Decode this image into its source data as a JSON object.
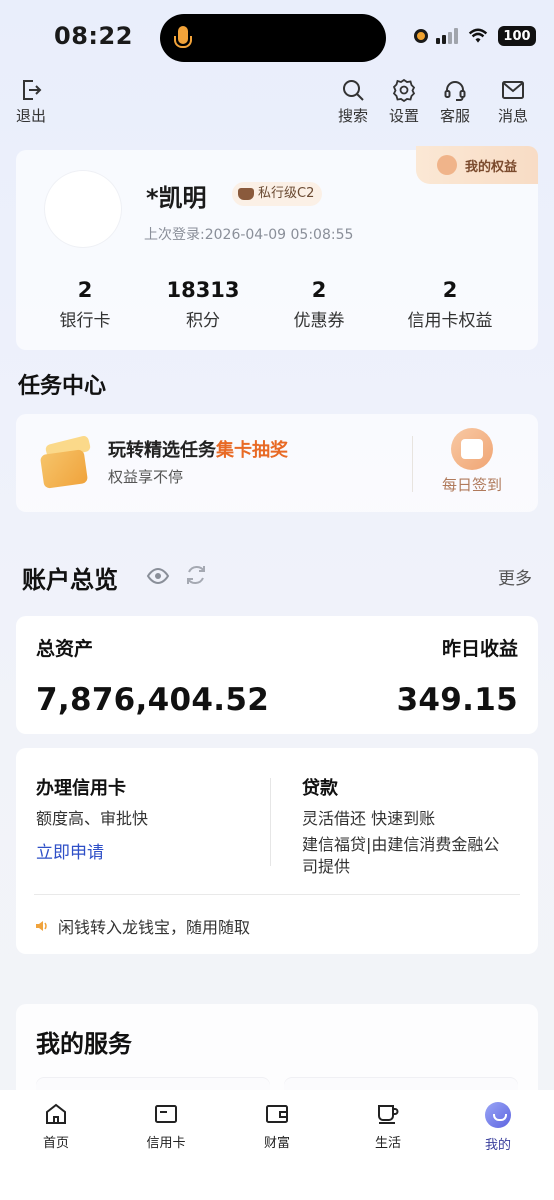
{
  "status_bar": {
    "time": "08:22",
    "battery": "100"
  },
  "top_nav": {
    "logout": "退出",
    "search": "搜索",
    "settings": "设置",
    "service": "客服",
    "messages": "消息"
  },
  "profile": {
    "name": "*凯明",
    "level": "私行级C2",
    "last_login": "上次登录:2026-04-09 05:08:55",
    "rights_tag": "我的权益",
    "stats": [
      {
        "value": "2",
        "label": "银行卡"
      },
      {
        "value": "18313",
        "label": "积分"
      },
      {
        "value": "2",
        "label": "优惠券"
      },
      {
        "value": "2",
        "label": "信用卡权益"
      }
    ]
  },
  "task_center": {
    "title": "任务中心",
    "headline": "玩转精选任务",
    "headline_highlight": "集卡抽奖",
    "subtitle": "权益享不停",
    "checkin": "每日签到"
  },
  "overview": {
    "title": "账户总览",
    "more": "更多",
    "total_assets_label": "总资产",
    "total_assets_value": "7,876,404.52",
    "yesterday_income_label": "昨日收益",
    "yesterday_income_value": "349.15"
  },
  "services_card": {
    "credit_title": "办理信用卡",
    "credit_desc": "额度高、审批快",
    "credit_link": "立即申请",
    "loan_title": "贷款",
    "loan_desc1": "灵活借还 快速到账",
    "loan_desc2": "建信福贷|由建信消费金融公",
    "loan_desc3": "司提供",
    "notice": "闲钱转入龙钱宝，随用随取"
  },
  "my_services": {
    "title": "我的服务"
  },
  "tabbar": {
    "items": [
      {
        "label": "首页",
        "icon": "home-icon"
      },
      {
        "label": "信用卡",
        "icon": "credit-card-icon"
      },
      {
        "label": "财富",
        "icon": "wallet-icon"
      },
      {
        "label": "生活",
        "icon": "cup-icon"
      },
      {
        "label": "我的",
        "icon": "profile-face-icon"
      }
    ],
    "active_index": 4
  },
  "colors": {
    "accent_orange": "#e86a25",
    "link_blue": "#2e4fc7",
    "active_tab": "#3a3f9c"
  }
}
